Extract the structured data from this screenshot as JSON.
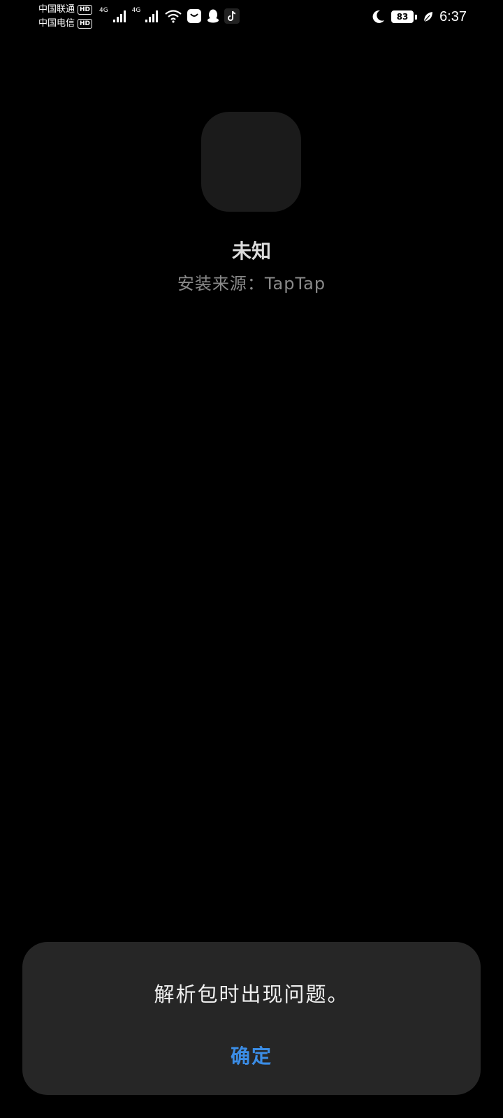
{
  "status_bar": {
    "carrier_1": "中国联通",
    "carrier_2": "中国电信",
    "hd_label": "HD",
    "network_1": "4G",
    "network_2": "4G",
    "battery_level": "83",
    "time": "6:37",
    "icons": [
      "wifi-icon",
      "bag-app-icon",
      "qq-icon",
      "tiktok-icon",
      "moon-icon",
      "leaf-icon"
    ]
  },
  "app": {
    "name": "未知",
    "install_source": "安装来源：TapTap"
  },
  "dialog": {
    "message": "解析包时出现问题。",
    "ok_label": "确定"
  },
  "colors": {
    "background": "#000000",
    "dialog_bg": "#262626",
    "accent": "#3b8de6"
  }
}
